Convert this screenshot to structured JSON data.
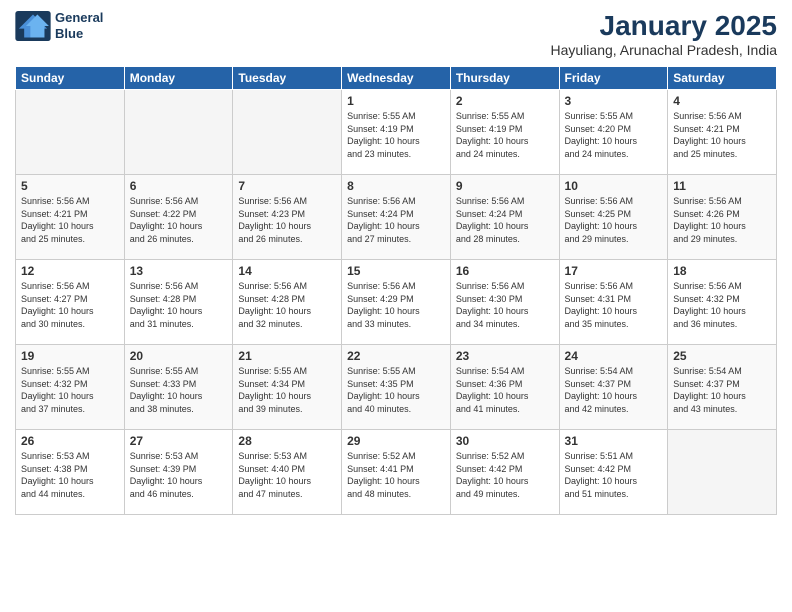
{
  "logo": {
    "line1": "General",
    "line2": "Blue"
  },
  "title": "January 2025",
  "subtitle": "Hayuliang, Arunachal Pradesh, India",
  "days_of_week": [
    "Sunday",
    "Monday",
    "Tuesday",
    "Wednesday",
    "Thursday",
    "Friday",
    "Saturday"
  ],
  "weeks": [
    [
      {
        "day": "",
        "info": ""
      },
      {
        "day": "",
        "info": ""
      },
      {
        "day": "",
        "info": ""
      },
      {
        "day": "1",
        "info": "Sunrise: 5:55 AM\nSunset: 4:19 PM\nDaylight: 10 hours\nand 23 minutes."
      },
      {
        "day": "2",
        "info": "Sunrise: 5:55 AM\nSunset: 4:19 PM\nDaylight: 10 hours\nand 24 minutes."
      },
      {
        "day": "3",
        "info": "Sunrise: 5:55 AM\nSunset: 4:20 PM\nDaylight: 10 hours\nand 24 minutes."
      },
      {
        "day": "4",
        "info": "Sunrise: 5:56 AM\nSunset: 4:21 PM\nDaylight: 10 hours\nand 25 minutes."
      }
    ],
    [
      {
        "day": "5",
        "info": "Sunrise: 5:56 AM\nSunset: 4:21 PM\nDaylight: 10 hours\nand 25 minutes."
      },
      {
        "day": "6",
        "info": "Sunrise: 5:56 AM\nSunset: 4:22 PM\nDaylight: 10 hours\nand 26 minutes."
      },
      {
        "day": "7",
        "info": "Sunrise: 5:56 AM\nSunset: 4:23 PM\nDaylight: 10 hours\nand 26 minutes."
      },
      {
        "day": "8",
        "info": "Sunrise: 5:56 AM\nSunset: 4:24 PM\nDaylight: 10 hours\nand 27 minutes."
      },
      {
        "day": "9",
        "info": "Sunrise: 5:56 AM\nSunset: 4:24 PM\nDaylight: 10 hours\nand 28 minutes."
      },
      {
        "day": "10",
        "info": "Sunrise: 5:56 AM\nSunset: 4:25 PM\nDaylight: 10 hours\nand 29 minutes."
      },
      {
        "day": "11",
        "info": "Sunrise: 5:56 AM\nSunset: 4:26 PM\nDaylight: 10 hours\nand 29 minutes."
      }
    ],
    [
      {
        "day": "12",
        "info": "Sunrise: 5:56 AM\nSunset: 4:27 PM\nDaylight: 10 hours\nand 30 minutes."
      },
      {
        "day": "13",
        "info": "Sunrise: 5:56 AM\nSunset: 4:28 PM\nDaylight: 10 hours\nand 31 minutes."
      },
      {
        "day": "14",
        "info": "Sunrise: 5:56 AM\nSunset: 4:28 PM\nDaylight: 10 hours\nand 32 minutes."
      },
      {
        "day": "15",
        "info": "Sunrise: 5:56 AM\nSunset: 4:29 PM\nDaylight: 10 hours\nand 33 minutes."
      },
      {
        "day": "16",
        "info": "Sunrise: 5:56 AM\nSunset: 4:30 PM\nDaylight: 10 hours\nand 34 minutes."
      },
      {
        "day": "17",
        "info": "Sunrise: 5:56 AM\nSunset: 4:31 PM\nDaylight: 10 hours\nand 35 minutes."
      },
      {
        "day": "18",
        "info": "Sunrise: 5:56 AM\nSunset: 4:32 PM\nDaylight: 10 hours\nand 36 minutes."
      }
    ],
    [
      {
        "day": "19",
        "info": "Sunrise: 5:55 AM\nSunset: 4:32 PM\nDaylight: 10 hours\nand 37 minutes."
      },
      {
        "day": "20",
        "info": "Sunrise: 5:55 AM\nSunset: 4:33 PM\nDaylight: 10 hours\nand 38 minutes."
      },
      {
        "day": "21",
        "info": "Sunrise: 5:55 AM\nSunset: 4:34 PM\nDaylight: 10 hours\nand 39 minutes."
      },
      {
        "day": "22",
        "info": "Sunrise: 5:55 AM\nSunset: 4:35 PM\nDaylight: 10 hours\nand 40 minutes."
      },
      {
        "day": "23",
        "info": "Sunrise: 5:54 AM\nSunset: 4:36 PM\nDaylight: 10 hours\nand 41 minutes."
      },
      {
        "day": "24",
        "info": "Sunrise: 5:54 AM\nSunset: 4:37 PM\nDaylight: 10 hours\nand 42 minutes."
      },
      {
        "day": "25",
        "info": "Sunrise: 5:54 AM\nSunset: 4:37 PM\nDaylight: 10 hours\nand 43 minutes."
      }
    ],
    [
      {
        "day": "26",
        "info": "Sunrise: 5:53 AM\nSunset: 4:38 PM\nDaylight: 10 hours\nand 44 minutes."
      },
      {
        "day": "27",
        "info": "Sunrise: 5:53 AM\nSunset: 4:39 PM\nDaylight: 10 hours\nand 46 minutes."
      },
      {
        "day": "28",
        "info": "Sunrise: 5:53 AM\nSunset: 4:40 PM\nDaylight: 10 hours\nand 47 minutes."
      },
      {
        "day": "29",
        "info": "Sunrise: 5:52 AM\nSunset: 4:41 PM\nDaylight: 10 hours\nand 48 minutes."
      },
      {
        "day": "30",
        "info": "Sunrise: 5:52 AM\nSunset: 4:42 PM\nDaylight: 10 hours\nand 49 minutes."
      },
      {
        "day": "31",
        "info": "Sunrise: 5:51 AM\nSunset: 4:42 PM\nDaylight: 10 hours\nand 51 minutes."
      },
      {
        "day": "",
        "info": ""
      }
    ]
  ]
}
